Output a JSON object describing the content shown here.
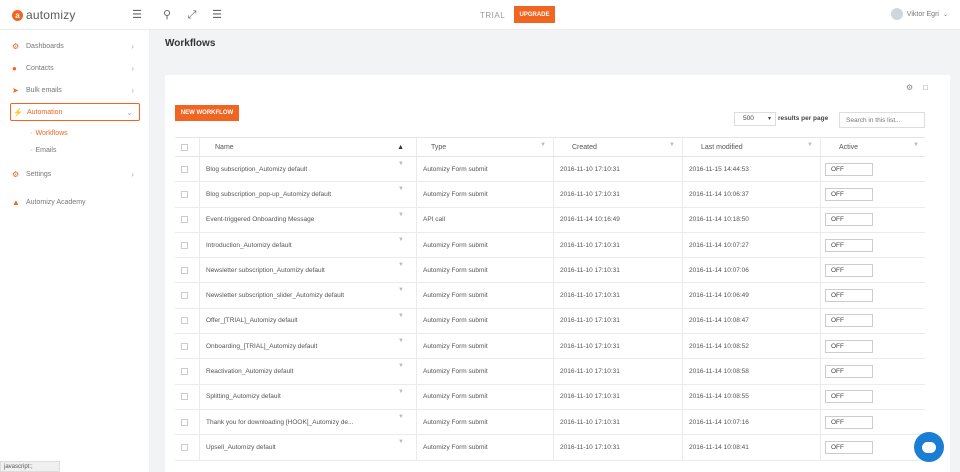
{
  "header": {
    "logo_text": "automizy",
    "trial_label": "TRIAL",
    "upgrade_label": "UPGRADE",
    "user_name": "Viktor Egri"
  },
  "sidebar": {
    "items": [
      {
        "label": "Dashboards",
        "icon": "dashboard-icon"
      },
      {
        "label": "Contacts",
        "icon": "contacts-icon"
      },
      {
        "label": "Bulk emails",
        "icon": "send-icon"
      },
      {
        "label": "Automation",
        "icon": "lightning-icon"
      },
      {
        "label": "Settings",
        "icon": "gears-icon"
      },
      {
        "label": "Automizy Academy",
        "icon": "graduation-cap-icon"
      }
    ],
    "sub_items": [
      {
        "label": "Workflows"
      },
      {
        "label": "Emails"
      }
    ]
  },
  "main": {
    "page_title": "Workflows",
    "new_button_label": "NEW WORKFLOW",
    "per_page_value": "500",
    "per_page_label": "results per page",
    "search_placeholder": "Search in this list...",
    "columns": [
      "Name",
      "Type",
      "Created",
      "Last modified",
      "Active"
    ],
    "rows": [
      {
        "name": "Blog subscription_Automizy default",
        "type": "Automizy Form submit",
        "created": "2016-11-10 17:10:31",
        "modified": "2016-11-15 14:44:53",
        "active": "OFF"
      },
      {
        "name": "Blog subscription_pop-up_Automizy default",
        "type": "Automizy Form submit",
        "created": "2016-11-10 17:10:31",
        "modified": "2016-11-14 10:06:37",
        "active": "OFF"
      },
      {
        "name": "Event-triggered Onboarding Message",
        "type": "API call",
        "created": "2016-11-14 10:16:49",
        "modified": "2016-11-14 10:18:50",
        "active": "OFF"
      },
      {
        "name": "Introduction_Automizy default",
        "type": "Automizy Form submit",
        "created": "2016-11-10 17:10:31",
        "modified": "2016-11-14 10:07:27",
        "active": "OFF"
      },
      {
        "name": "Newsletter subscription_Automizy default",
        "type": "Automizy Form submit",
        "created": "2016-11-10 17:10:31",
        "modified": "2016-11-14 10:07:06",
        "active": "OFF"
      },
      {
        "name": "Newsletter subscription_slider_Automizy default",
        "type": "Automizy Form submit",
        "created": "2016-11-10 17:10:31",
        "modified": "2016-11-14 10:06:49",
        "active": "OFF"
      },
      {
        "name": "Offer_[TRIAL]_Automizy default",
        "type": "Automizy Form submit",
        "created": "2016-11-10 17:10:31",
        "modified": "2016-11-14 10:08:47",
        "active": "OFF"
      },
      {
        "name": "Onboarding_[TRIAL]_Automizy default",
        "type": "Automizy Form submit",
        "created": "2016-11-10 17:10:31",
        "modified": "2016-11-14 10:08:52",
        "active": "OFF"
      },
      {
        "name": "Reactivation_Automizy default",
        "type": "Automizy Form submit",
        "created": "2016-11-10 17:10:31",
        "modified": "2016-11-14 10:08:58",
        "active": "OFF"
      },
      {
        "name": "Splitting_Automizy default",
        "type": "Automizy Form submit",
        "created": "2016-11-10 17:10:31",
        "modified": "2016-11-14 10:08:55",
        "active": "OFF"
      },
      {
        "name": "Thank you for downloading [HOOK]_Automizy de...",
        "type": "Automizy Form submit",
        "created": "2016-11-10 17:10:31",
        "modified": "2016-11-14 10:07:16",
        "active": "OFF"
      },
      {
        "name": "Upsell_Automizy default",
        "type": "Automizy Form submit",
        "created": "2016-11-10 17:10:31",
        "modified": "2016-11-14 10:08:41",
        "active": "OFF"
      }
    ]
  },
  "statusbar": {
    "text": "javascript:;"
  },
  "colors": {
    "accent": "#f16522",
    "chat": "#1a7fd4",
    "content_bg": "#f2f3f4"
  }
}
